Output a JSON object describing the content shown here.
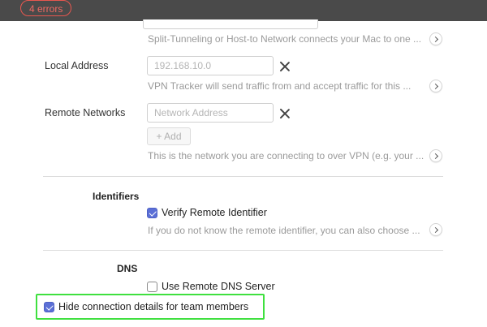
{
  "header": {
    "error_badge": "4 errors"
  },
  "topology": {
    "hint": "Split-Tunneling or Host-to Network connects your Mac to one ..."
  },
  "local_address": {
    "label": "Local Address",
    "placeholder": "192.168.10.0",
    "hint": "VPN Tracker will send traffic from and accept traffic for this ..."
  },
  "remote_networks": {
    "label": "Remote Networks",
    "placeholder": "Network Address",
    "add_label": "+ Add",
    "hint": "This is the network you are connecting to over VPN (e.g. your ..."
  },
  "identifiers": {
    "section_label": "Identifiers",
    "verify_label": "Verify Remote Identifier",
    "verify_checked": true,
    "hint": "If you do not know the remote identifier, you can also choose ..."
  },
  "dns": {
    "section_label": "DNS",
    "use_remote_dns_label": "Use Remote DNS Server",
    "use_remote_dns_checked": false
  },
  "team": {
    "hide_details_label": "Hide connection details for team members",
    "hide_details_checked": true
  },
  "colors": {
    "accent": "#5b6fd6",
    "error": "#e8574f",
    "highlight": "#3fe03f",
    "topbar": "#4a4a4a"
  }
}
